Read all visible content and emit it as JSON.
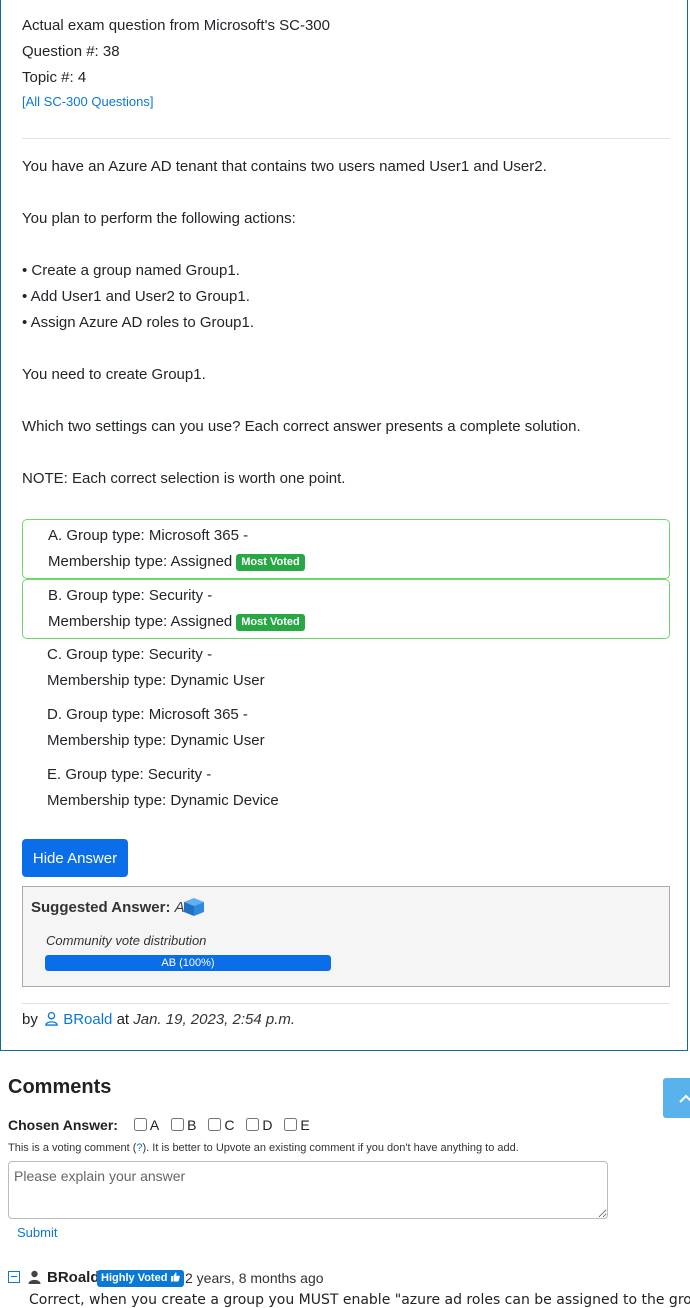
{
  "header": {
    "exam_line": "Actual exam question from Microsoft's SC-300",
    "question_num": "Question #: 38",
    "topic_num": "Topic #: 4",
    "all_questions_link": "[All SC-300 Questions]"
  },
  "question": {
    "p1": "You have an Azure AD tenant that contains two users named User1 and User2.",
    "p2": "You plan to perform the following actions:",
    "b1": "• Create a group named Group1.",
    "b2": "• Add User1 and User2 to Group1.",
    "b3": "• Assign Azure AD roles to Group1.",
    "p3": "You need to create Group1.",
    "p4": "Which two settings can you use? Each correct answer presents a complete solution.",
    "p5": "NOTE: Each correct selection is worth one point."
  },
  "choices": [
    {
      "line1": "A. Group type: Microsoft 365 -",
      "line2": "Membership type: Assigned",
      "badge": "Most Voted"
    },
    {
      "line1": "B. Group type: Security -",
      "line2": "Membership type: Assigned",
      "badge": "Most Voted"
    },
    {
      "line1": "C. Group type: Security -",
      "line2": "Membership type: Dynamic User"
    },
    {
      "line1": "D. Group type: Microsoft 365 -",
      "line2": "Membership type: Dynamic User"
    },
    {
      "line1": "E. Group type: Security -",
      "line2": "Membership type: Dynamic Device"
    }
  ],
  "hide_answer_label": "Hide Answer",
  "suggested": {
    "label": "Suggested Answer:",
    "answer": "AB",
    "vote_dist_label": "Community vote distribution",
    "bar_text": "AB (100%)",
    "bar_fraction": 1.0
  },
  "byline": {
    "by": "by",
    "user": "BRoald",
    "at": "at",
    "date": "Jan. 19, 2023, 2:54 p.m."
  },
  "comments": {
    "heading": "Comments",
    "chosen_label": "Chosen Answer:",
    "options": [
      "A",
      "B",
      "C",
      "D",
      "E"
    ],
    "vote_note_pre": "This is a voting comment (",
    "vote_note_q": "?",
    "vote_note_post": "). It is better to Upvote an existing comment if you don't have anything to add.",
    "placeholder": "Please explain your answer",
    "submit": "Submit",
    "items": [
      {
        "user": "BRoald",
        "badge": "Highly Voted",
        "time": "2 years, 8 months ago",
        "text": "Correct, when you create a group you MUST enable \"azure ad roles can be assigned to the group\""
      }
    ]
  },
  "colors": {
    "accent": "#0a6ee8",
    "most_voted": "#28a745",
    "correct_border": "#6cd96a"
  },
  "icons": {
    "user": "user-outline-icon",
    "cube": "cube-icon",
    "scroll_top": "chevron-up-icon",
    "person": "person-icon",
    "thumbs_up": "thumbs-up-icon",
    "collapse": "minus-square-icon"
  }
}
